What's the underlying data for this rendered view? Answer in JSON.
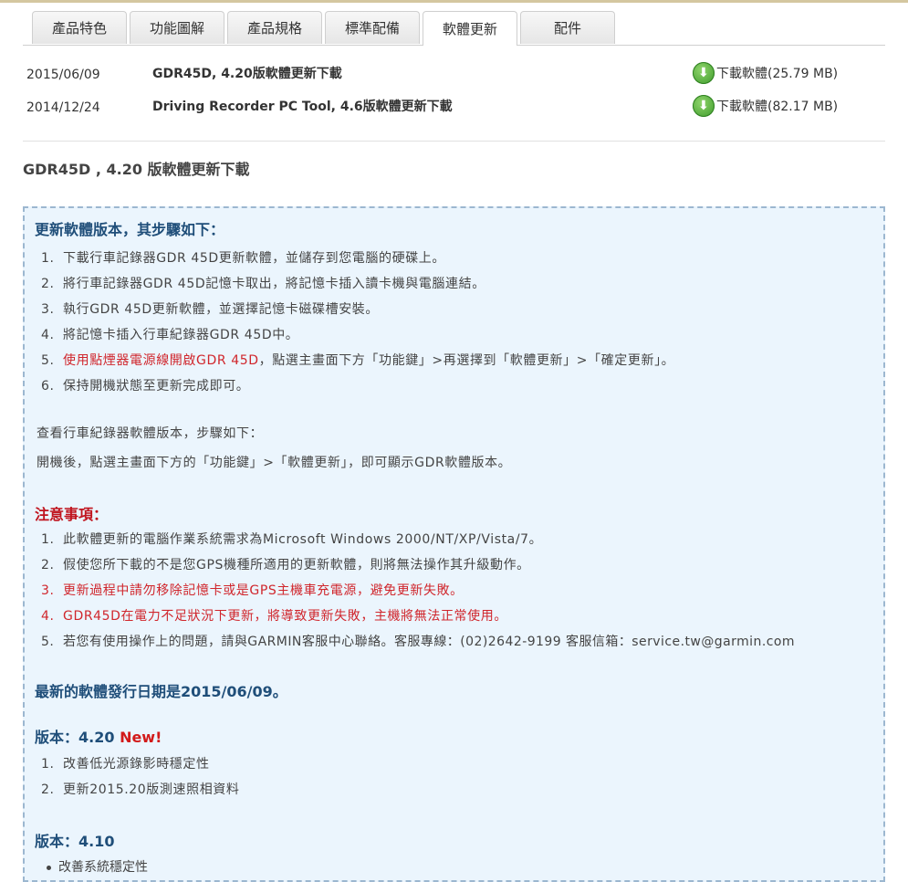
{
  "tabs": [
    {
      "label": "產品特色"
    },
    {
      "label": "功能圖解"
    },
    {
      "label": "產品規格"
    },
    {
      "label": "標準配備"
    },
    {
      "label": "軟體更新"
    },
    {
      "label": "配件"
    }
  ],
  "downloads": [
    {
      "date": "2015/06/09",
      "title": "GDR45D, 4.20版軟體更新下載",
      "link": "下載軟體(25.79 MB)"
    },
    {
      "date": "2014/12/24",
      "title": "Driving Recorder PC Tool, 4.6版軟體更新下載",
      "link": "下載軟體(82.17 MB)"
    }
  ],
  "section_title": "GDR45D , 4.20 版軟體更新下載",
  "steps": {
    "heading": "更新軟體版本，其步驟如下：",
    "items": [
      "下載行車記錄器GDR 45D更新軟體，並儲存到您電腦的硬碟上。",
      "將行車記錄器GDR 45D記憶卡取出，將記憶卡插入讀卡機與電腦連結。",
      "執行GDR 45D更新軟體，並選擇記憶卡磁碟槽安裝。",
      "將記憶卡插入行車紀錄器GDR 45D中。"
    ],
    "item5_red": "使用點煙器電源線開啟GDR 45D",
    "item5_rest": "，點選主畫面下方「功能鍵」>再選擇到「軟體更新」>「確定更新」。",
    "item6": "保持開機狀態至更新完成即可。"
  },
  "check": {
    "line1": "查看行車紀錄器軟體版本，步驟如下：",
    "line2": "開機後，點選主畫面下方的「功能鍵」>「軟體更新」，即可顯示GDR軟體版本。"
  },
  "notes": {
    "heading": "注意事項：",
    "items": [
      "此軟體更新的電腦作業系統需求為Microsoft Windows 2000/NT/XP/Vista/7。",
      "假使您所下載的不是您GPS機種所適用的更新軟體，則將無法操作其升級動作。",
      "更新過程中請勿移除記憶卡或是GPS主機車充電源，避免更新失敗。",
      "GDR45D在電力不足狀況下更新，將導致更新失敗，主機將無法正常使用。",
      "若您有使用操作上的問題，請與GARMIN客服中心聯絡。客服專線：(02)2642-9199 客服信箱：service.tw@garmin.com"
    ]
  },
  "release": {
    "prefix": "最新的軟體發行日期是",
    "date": "2015/06/09",
    "suffix": "。"
  },
  "v420": {
    "label": "版本：4.20 ",
    "new": "New!",
    "items": [
      "改善低光源錄影時穩定性",
      "更新2015.20版測速照相資料"
    ]
  },
  "v410": {
    "label": "版本：4.10",
    "items": [
      "改善系統穩定性"
    ]
  },
  "colors": {
    "accent_blue": "#1f4e79",
    "warning_red": "#c0141e",
    "box_bg": "#ebf5fd",
    "download_green": "#3c9a2a"
  },
  "icons": {
    "download": "download-arrow-icon"
  }
}
